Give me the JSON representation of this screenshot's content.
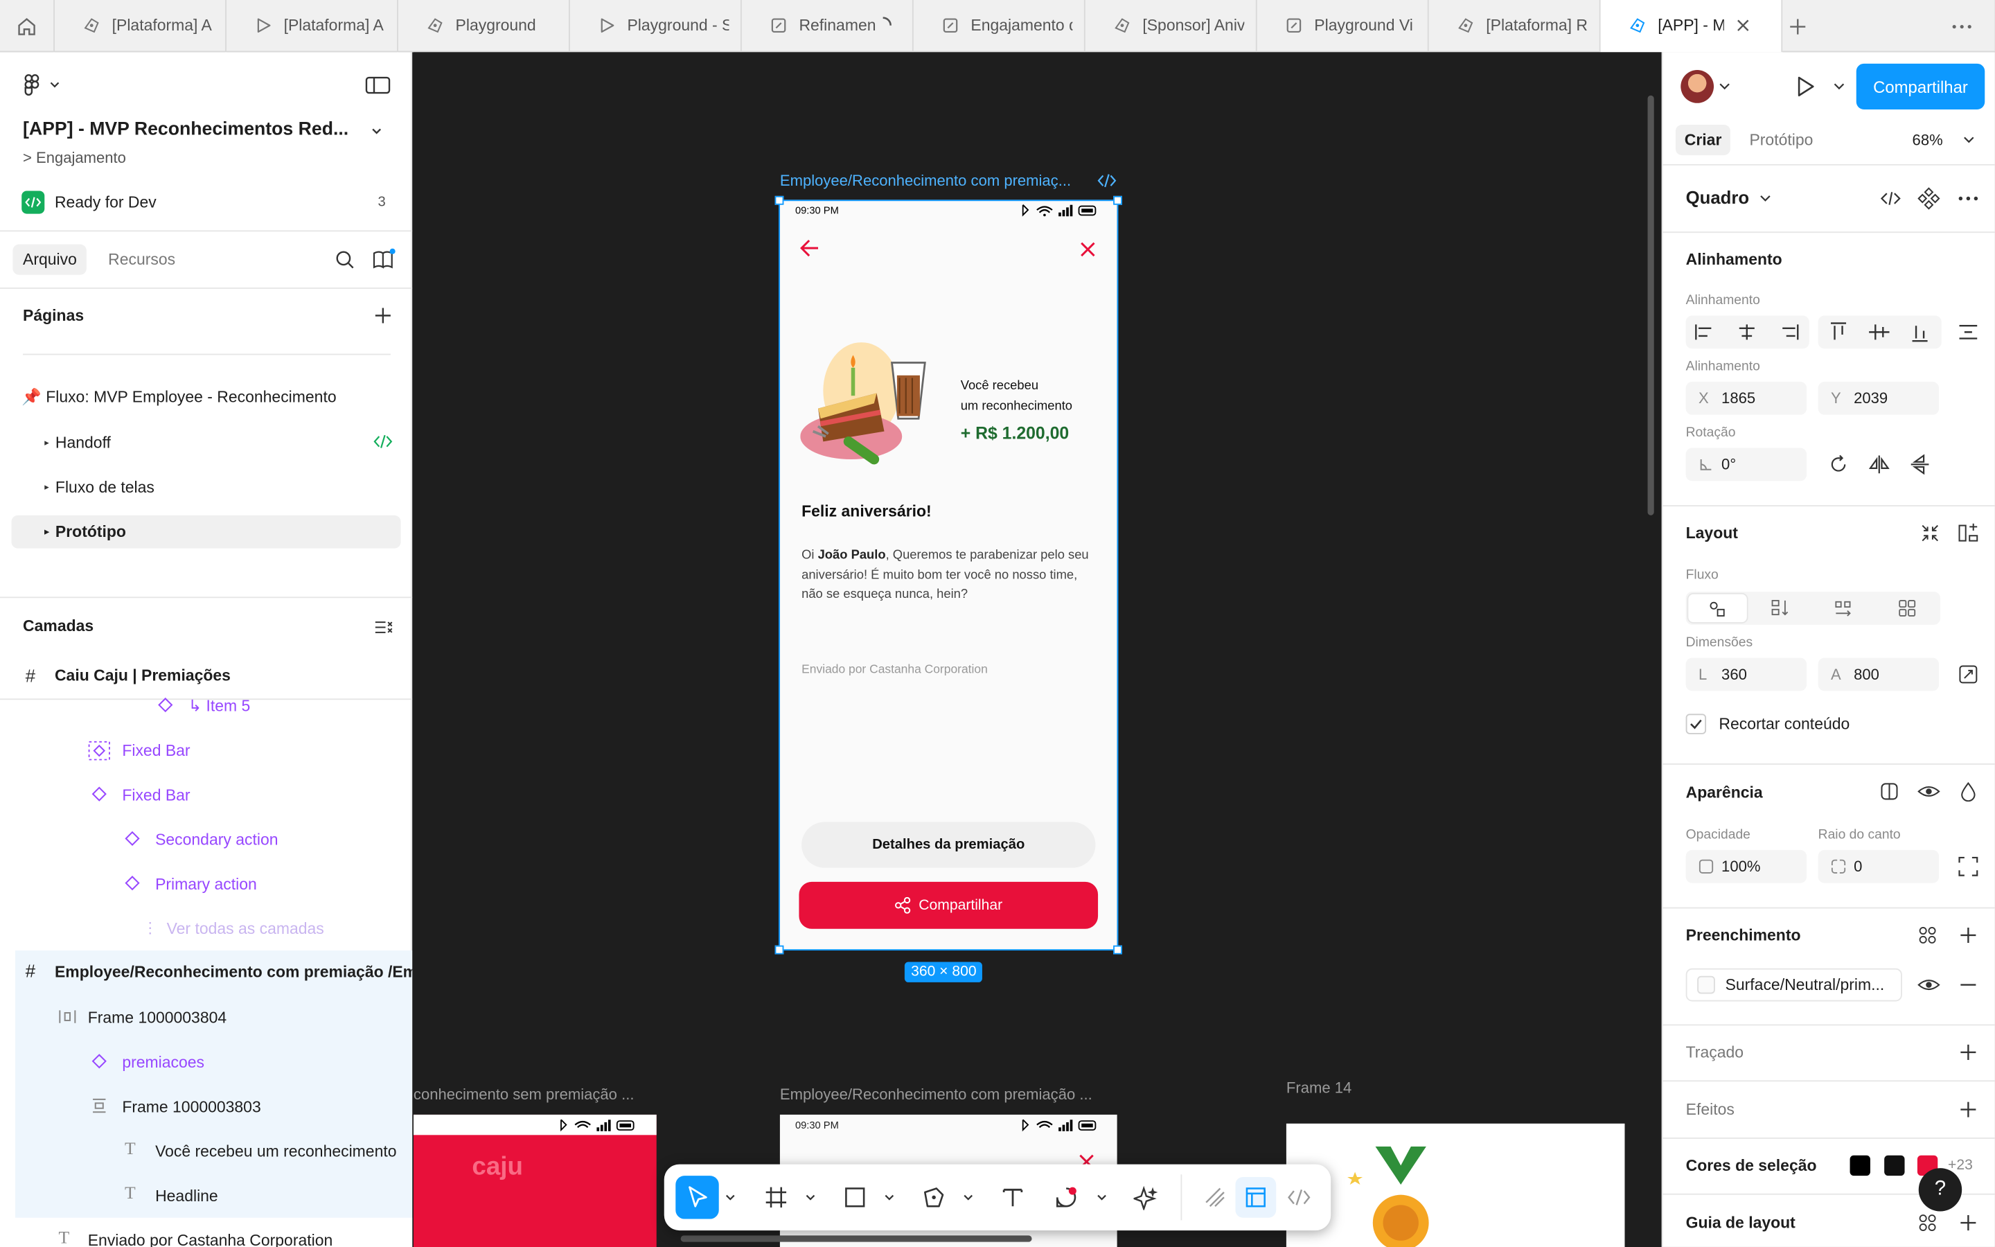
{
  "tabs": [
    {
      "label": "[Plataforma] A",
      "icon": "figjam-icon"
    },
    {
      "label": "[Plataforma] A",
      "icon": "play-icon"
    },
    {
      "label": "Playground",
      "icon": "figjam-icon"
    },
    {
      "label": "Playground - S",
      "icon": "play-icon"
    },
    {
      "label": "Refinamen",
      "icon": "slides-icon"
    },
    {
      "label": "Engajamento d",
      "icon": "slides-icon"
    },
    {
      "label": "[Sponsor] Aniv",
      "icon": "figjam-icon"
    },
    {
      "label": "Playground Vi",
      "icon": "slides-icon"
    },
    {
      "label": "[Plataforma] R",
      "icon": "figjam-icon"
    },
    {
      "label": "[APP] - M",
      "icon": "figjam-icon",
      "active": true
    }
  ],
  "left": {
    "file_title": "[APP] - MVP Reconhecimentos Red...",
    "breadcrumb": "> Engajamento",
    "ready_for_dev": "Ready for Dev",
    "ready_count": "3",
    "tab_file": "Arquivo",
    "tab_resources": "Recursos",
    "pages_header": "Páginas",
    "pages": [
      {
        "label": "📌 Fluxo: MVP Employee - Reconhecimento"
      },
      {
        "label": "Handoff"
      },
      {
        "label": "Fluxo de telas"
      },
      {
        "label": "Protótipo"
      }
    ],
    "layers_header": "Camadas",
    "layer_root": "Caiu Caju | Premiações",
    "layers": [
      {
        "label": "↳ Item 5"
      },
      {
        "label": "Fixed Bar"
      },
      {
        "label": "Fixed Bar"
      },
      {
        "label": "Secondary action"
      },
      {
        "label": "Primary action"
      },
      {
        "label": "Ver todas as camadas"
      },
      {
        "label": "Employee/Reconhecimento com premiação /Em"
      },
      {
        "label": "Frame 1000003804"
      },
      {
        "label": "premiacoes"
      },
      {
        "label": "Frame 1000003803"
      },
      {
        "label": "Você recebeu um reconhecimento"
      },
      {
        "label": "Headline"
      },
      {
        "label": "Enviado por Castanha Corporation"
      }
    ]
  },
  "canvas": {
    "frame_title": "Employee/Reconhecimento com premiaç...",
    "size_badge": "360 × 800",
    "phone": {
      "time": "09:30 PM",
      "received_line1": "Você recebeu",
      "received_line2": "um reconhecimento",
      "amount": "+ R$ 1.200,00",
      "headline": "Feliz aniversário!",
      "body_prefix": "Oi ",
      "body_name": "João Paulo",
      "body_rest": ", Queremos te parabenizar pelo seu aniversário! É muito bom ter você no nosso time, não se esqueça nunca, hein?",
      "sender": "Enviado por Castanha Corporation",
      "secondary_button": "Detalhes da premiação",
      "primary_button": "Compartilhar"
    },
    "bottom_labels": [
      "conhecimento sem premiação ...",
      "Employee/Reconhecimento com premiação ...",
      "Frame 14"
    ],
    "bottom_time": "09:30 PM",
    "bottom_logo": "caju"
  },
  "right": {
    "share_button": "Compartilhar",
    "tab_create": "Criar",
    "tab_prototype": "Protótipo",
    "zoom": "68%",
    "frame_type": "Quadro",
    "alignment_header": "Alinhamento",
    "alignment_label": "Alinhamento",
    "position_label": "Alinhamento",
    "x_key": "X",
    "x_value": "1865",
    "y_key": "Y",
    "y_value": "2039",
    "rotation_label": "Rotação",
    "rotation_value": "0°",
    "layout_header": "Layout",
    "flow_label": "Fluxo",
    "dimensions_label": "Dimensões",
    "w_key": "L",
    "w_value": "360",
    "h_key": "A",
    "h_value": "800",
    "clip_content": "Recortar conteúdo",
    "appearance_header": "Aparência",
    "opacity_label": "Opacidade",
    "opacity_value": "100%",
    "radius_label": "Raio do canto",
    "radius_value": "0",
    "fill_header": "Preenchimento",
    "fill_value": "Surface/Neutral/prim...",
    "stroke_header": "Traçado",
    "effects_header": "Efeitos",
    "selection_colors_header": "Cores de seleção",
    "selection_colors_more": "+23",
    "layout_guide_header": "Guia de layout",
    "help": "?"
  },
  "colors": {
    "accent": "#0d99ff",
    "primary_red": "#e8103a",
    "green": "#1e6b2f",
    "purple": "#9747ff"
  }
}
